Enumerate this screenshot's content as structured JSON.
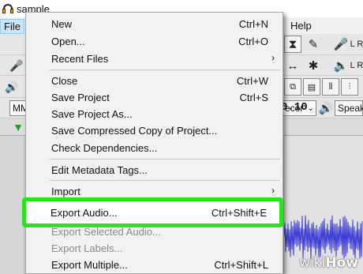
{
  "window": {
    "title": "sample"
  },
  "menubar": {
    "file": "File",
    "help": "Help"
  },
  "toolbar": {
    "recording_device": "ecor",
    "playback_device": "Speak",
    "left_dropdown": "MM",
    "time_readout": "0.10"
  },
  "file_menu": {
    "items": [
      {
        "label": "New",
        "shortcut": "Ctrl+N"
      },
      {
        "label": "Open...",
        "shortcut": "Ctrl+O"
      },
      {
        "label": "Recent Files",
        "shortcut": "",
        "submenu_arrow": "›"
      },
      {
        "label": "Close",
        "shortcut": "Ctrl+W"
      },
      {
        "label": "Save Project",
        "shortcut": "Ctrl+S"
      },
      {
        "label": "Save Project As...",
        "shortcut": ""
      },
      {
        "label": "Save Compressed Copy of Project...",
        "shortcut": ""
      },
      {
        "label": "Check Dependencies...",
        "shortcut": ""
      },
      {
        "label": "Edit Metadata Tags...",
        "shortcut": ""
      },
      {
        "label": "Import",
        "shortcut": "",
        "submenu_arrow": "›"
      },
      {
        "label": "Export Audio...",
        "shortcut": "Ctrl+Shift+E"
      },
      {
        "label": "Export Selected Audio...",
        "shortcut": ""
      },
      {
        "label": "Export Labels...",
        "shortcut": ""
      },
      {
        "label": "Export Multiple...",
        "shortcut": "Ctrl+Shift+L"
      }
    ]
  },
  "watermark": {
    "prefix": "wiki",
    "suffix": "How"
  },
  "colors": {
    "highlight": "#2ee01f",
    "waveform": "#3b3bd6"
  }
}
